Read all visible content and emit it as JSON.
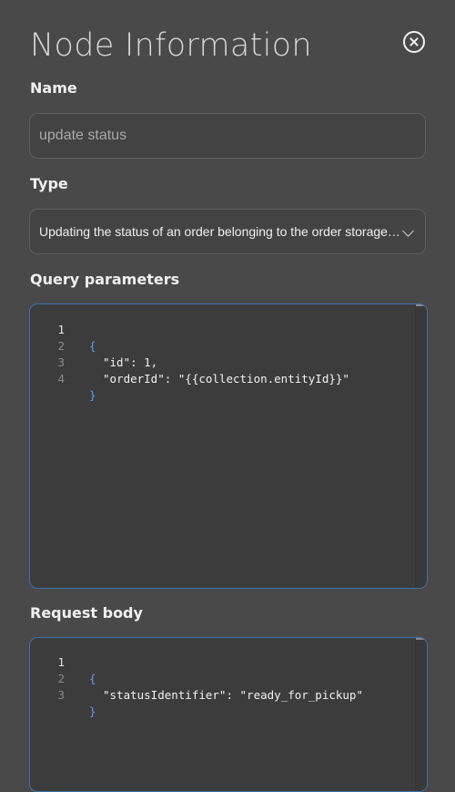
{
  "dialog": {
    "title": "Node Information",
    "close_icon": "close-circle-icon"
  },
  "name": {
    "label": "Name",
    "value": "update status"
  },
  "type": {
    "label": "Type",
    "value": "Updating the status of an order belonging to the order storage object"
  },
  "query": {
    "label": "Query parameters",
    "lines": [
      {
        "n": "1",
        "text": "{"
      },
      {
        "n": "2",
        "text": "\"id\": 1,"
      },
      {
        "n": "3",
        "text": "\"orderId\": \"{{collection.entityId}}\""
      },
      {
        "n": "4",
        "text": "}"
      }
    ]
  },
  "body": {
    "label": "Request body",
    "lines": [
      {
        "n": "1",
        "text": "{"
      },
      {
        "n": "2",
        "text": "\"statusIdentifier\": \"ready_for_pickup\""
      },
      {
        "n": "3",
        "text": "}"
      }
    ]
  },
  "colors": {
    "background": "#4a4949",
    "editor_border": "#3d72a8",
    "brace": "#5a9fe8"
  }
}
